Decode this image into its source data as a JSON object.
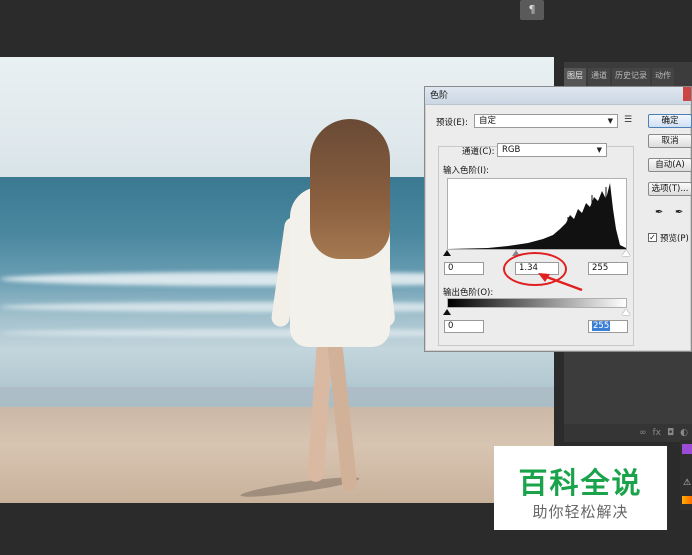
{
  "dialog": {
    "title": "色阶",
    "preset_label": "预设(E):",
    "preset_value": "自定",
    "channel_label": "通道(C):",
    "channel_value": "RGB",
    "input_levels_label": "输入色阶(I):",
    "input_black": "0",
    "input_gamma": "1.34",
    "input_white": "255",
    "output_levels_label": "输出色阶(O):",
    "output_black": "0",
    "output_white": "255",
    "ok_button": "确定",
    "cancel_button": "取消",
    "auto_button": "自动(A)",
    "options_button": "选项(T)...",
    "preview_label": "预览(P)",
    "preview_checked": true
  },
  "right_panel": {
    "tabs": [
      "图层",
      "通道",
      "历史记录",
      "动作"
    ]
  },
  "watermark": {
    "title": "百科全说",
    "subtitle": "助你轻松解决"
  },
  "colors": {
    "accent_red": "#e02020",
    "watermark_green": "#1aa34a"
  }
}
